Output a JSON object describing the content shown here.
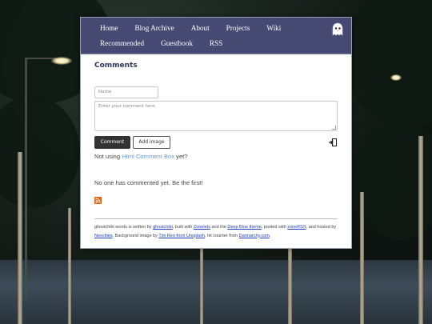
{
  "nav": {
    "row1": [
      "Home",
      "Blog Archive",
      "About",
      "Projects",
      "Wiki"
    ],
    "row2": [
      "Recommended",
      "Guestbook",
      "RSS"
    ]
  },
  "comments": {
    "title": "Comments",
    "name_placeholder": "Name",
    "comment_placeholder": "Enter your comment here",
    "comment_button": "Comment",
    "add_image_button": "Add image",
    "not_using_prefix": "Not using ",
    "not_using_link": "Html Comment Box",
    "not_using_suffix": "  yet?",
    "empty_message": "No one has commented yet. Be the first!"
  },
  "footer": {
    "p1": "ghostchibi words is written by ",
    "l1": "ghostchibi",
    "p2": ", built with ",
    "l2": "Zonelets",
    "p3": " and the ",
    "l3": "Deep Blue theme",
    "p4": ", posted with ",
    "l4": "zoneRSS",
    "p5": ", and hosted by ",
    "l5": "Neocities",
    "p6": ". Background image by ",
    "l6": "Tim Ren from Unsplash",
    "p7": ", hit counter from ",
    "l7": "Dannarchy.com",
    "p8": "."
  },
  "colors": {
    "nav_bg": "#464a72",
    "title": "#2d3558",
    "link": "#6f98d8",
    "footer_link": "#1a3cc4",
    "rss": "#e8641b"
  },
  "icons": [
    "ghost-icon",
    "login-icon",
    "rss-icon"
  ]
}
